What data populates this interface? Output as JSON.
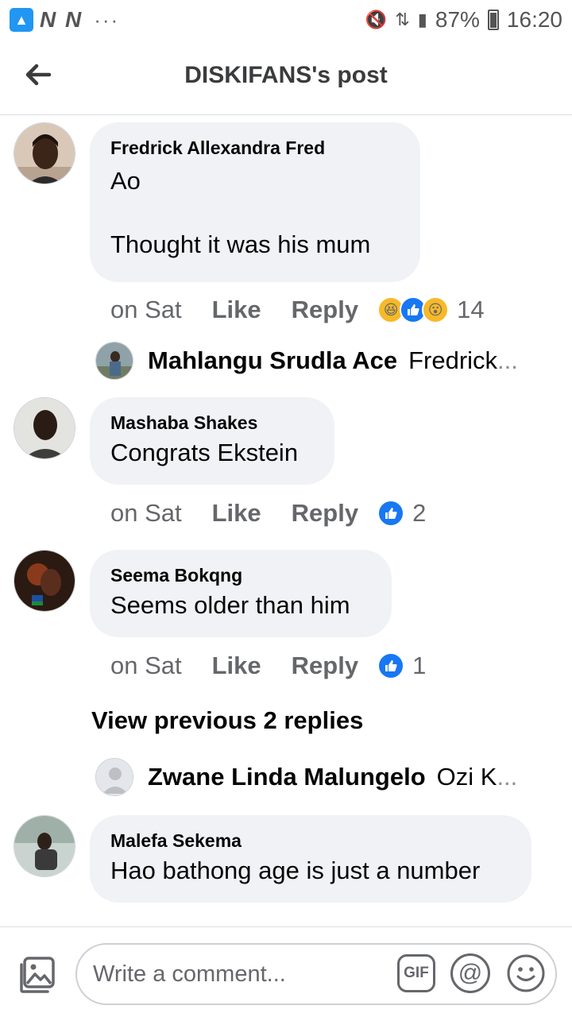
{
  "status_bar": {
    "left_labels": "N N",
    "overflow": "···",
    "battery": "87%",
    "time": "16:20"
  },
  "header": {
    "title": "DISKIFANS's post"
  },
  "comments": [
    {
      "author": "Fredrick Allexandra Fred",
      "text": "Ao\n\nThought it was his mum",
      "time": "on Sat",
      "like": "Like",
      "reply": "Reply",
      "reactions": [
        "haha-icon",
        "like-icon",
        "wow-icon"
      ],
      "reaction_count": "14"
    },
    {
      "author": "Mashaba Shakes",
      "text": "Congrats Ekstein",
      "time": "on Sat",
      "like": "Like",
      "reply": "Reply",
      "reactions": [
        "like-icon"
      ],
      "reaction_count": "2"
    },
    {
      "author": "Seema Bokqng",
      "text": "Seems older than him",
      "time": "on Sat",
      "like": "Like",
      "reply": "Reply",
      "reactions": [
        "like-icon"
      ],
      "reaction_count": "1"
    },
    {
      "author": "Malefa Sekema",
      "text": "Hao bathong age is just a number"
    }
  ],
  "replies": [
    {
      "name": "Mahlangu Srudla Ace",
      "snippet": "Fredrick"
    },
    {
      "name": "Zwane Linda Malungelo",
      "snippet": "Ozi K"
    }
  ],
  "view_previous": "View previous 2 replies",
  "ellipsis": "...",
  "composer": {
    "placeholder": "Write a comment...",
    "gif_label": "GIF",
    "at_label": "@"
  },
  "colors": {
    "bubble": "#f0f2f5",
    "like_blue": "#1877f2",
    "secondary_text": "#65676b"
  }
}
